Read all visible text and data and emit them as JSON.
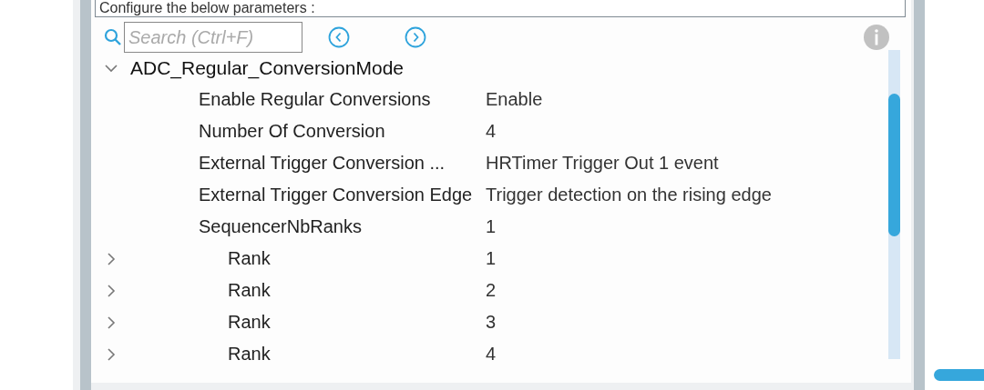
{
  "description": "Configure the below parameters :",
  "search": {
    "placeholder": "Search (Ctrl+F)"
  },
  "tree": {
    "label": "ADC_Regular_ConversionMode",
    "expanded": true,
    "children": [
      {
        "kind": "setting",
        "name": "Enable Regular Conversions",
        "value": "Enable"
      },
      {
        "kind": "setting",
        "name": "Number Of Conversion",
        "value": "4"
      },
      {
        "kind": "setting",
        "name": "External Trigger Conversion ...",
        "value": "HRTimer Trigger Out 1 event"
      },
      {
        "kind": "setting",
        "name": "External Trigger Conversion Edge",
        "value": "Trigger detection on the rising edge"
      },
      {
        "kind": "setting",
        "name": "SequencerNbRanks",
        "value": "1"
      },
      {
        "kind": "rank",
        "name": "Rank",
        "value": "1",
        "expanded": false
      },
      {
        "kind": "rank",
        "name": "Rank",
        "value": "2",
        "expanded": false
      },
      {
        "kind": "rank",
        "name": "Rank",
        "value": "3",
        "expanded": false
      },
      {
        "kind": "rank",
        "name": "Rank",
        "value": "4",
        "expanded": false
      }
    ]
  }
}
